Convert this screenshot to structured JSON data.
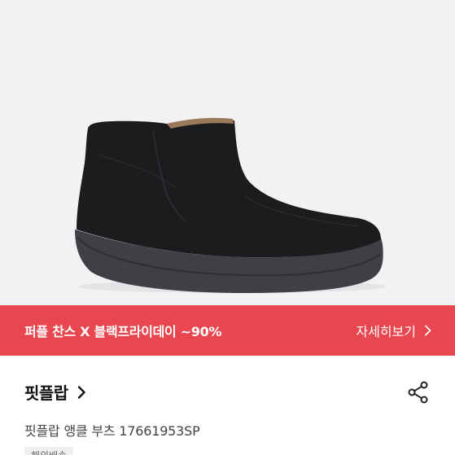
{
  "promo": {
    "title": "퍼플 찬스 X 블랙프라이데이 ~90%",
    "more_label": "자세히보기"
  },
  "product": {
    "brand": "핏플랍",
    "name": "핏플랍 앵클 부츠 17661953SP",
    "badge": "해외배송",
    "image_icon": "ankle-boot-image"
  },
  "colors": {
    "promo_bg": "#e8474f",
    "image_bg": "#f2f2f4"
  }
}
